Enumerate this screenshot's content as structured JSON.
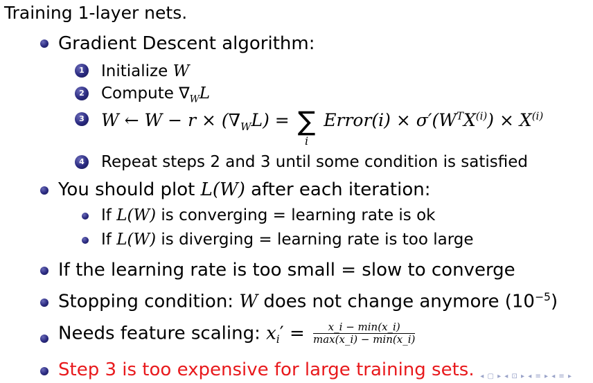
{
  "title": "Training 1-layer nets.",
  "items": {
    "gradient_descent": "Gradient Descent algorithm:",
    "steps": {
      "s1_num": "1",
      "s1_text": "Initialize",
      "s1_var": "W",
      "s2_num": "2",
      "s2_text": "Compute ∇",
      "s2_sub": "W",
      "s2_var": "L",
      "s3_num": "3",
      "s3_lhs": "W ← W − r × (∇",
      "s3_lhs_sub": "W",
      "s3_lhs_end": "L) =",
      "s3_sum": "∑",
      "s3_sum_sub": "i",
      "s3_rhs": "Error(i) × σ′(W",
      "s3_rhs_supT": "T",
      "s3_rhs_X": "X",
      "s3_rhs_supI": "(i)",
      "s3_rhs_tail": ") × X",
      "s3_rhs_tail_sup": "(i)",
      "s4_num": "4",
      "s4_text": "Repeat steps 2 and 3 until some condition is satisfied"
    },
    "plot_pre": "You should plot",
    "plot_func": "L(W)",
    "plot_post": "after each iteration:",
    "sub1_pre": "If",
    "sub1_func": "L(W)",
    "sub1_post": "is converging = learning rate is ok",
    "sub2_pre": "If",
    "sub2_func": "L(W)",
    "sub2_post": "is diverging = learning rate is too large",
    "small_rate": "If the learning rate is too small = slow to converge",
    "stopping_pre": "Stopping condition:",
    "stopping_var": "W",
    "stopping_post": "does not change anymore (10",
    "stopping_exp": "−5",
    "stopping_end": ")",
    "scaling_pre": "Needs feature scaling:",
    "scaling_lhs": "x",
    "scaling_lhs_sub": "i",
    "scaling_eq": "′ =",
    "scaling_num": "x_i − min(x_i)",
    "scaling_den": "max(x_i) − min(x_i)",
    "expensive": "Step 3 is too expensive for large training sets."
  },
  "nav_symbols": "◂ ▢ ▸ ◂ ⊡ ▸ ◂ ≡ ▸ ◂ ≡ ▸",
  "colors": {
    "bullet": "#2a2a80",
    "highlight": "#e8191c",
    "nav": "#9aa3c9"
  }
}
